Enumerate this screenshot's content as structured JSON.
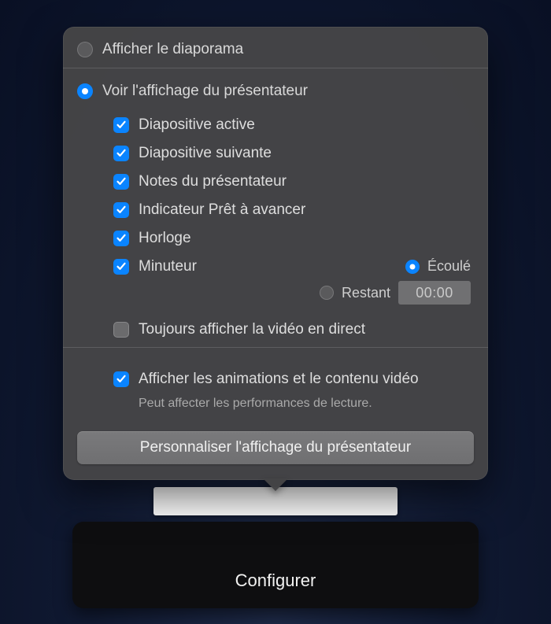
{
  "bottomBar": {
    "label": "Configurer"
  },
  "topRadio": {
    "slideshow": {
      "label": "Afficher le diaporama",
      "selected": false
    },
    "presenter": {
      "label": "Voir l'affichage du présentateur",
      "selected": true
    }
  },
  "checks": {
    "current": {
      "label": "Diapositive active",
      "checked": true
    },
    "next": {
      "label": "Diapositive suivante",
      "checked": true
    },
    "notes": {
      "label": "Notes du présentateur",
      "checked": true
    },
    "ready": {
      "label": "Indicateur Prêt à avancer",
      "checked": true
    },
    "clock": {
      "label": "Horloge",
      "checked": true
    },
    "timer": {
      "label": "Minuteur",
      "checked": true
    }
  },
  "timer": {
    "elapsed": {
      "label": "Écoulé",
      "selected": true
    },
    "remaining": {
      "label": "Restant",
      "selected": false
    },
    "value": "00:00"
  },
  "live": {
    "always": {
      "label": "Toujours afficher la vidéo en direct",
      "checked": false
    }
  },
  "animations": {
    "show": {
      "label": "Afficher les animations et le contenu vidéo",
      "checked": true
    },
    "note": "Peut affecter les performances de lecture."
  },
  "customizeButton": "Personnaliser l'affichage du présentateur"
}
